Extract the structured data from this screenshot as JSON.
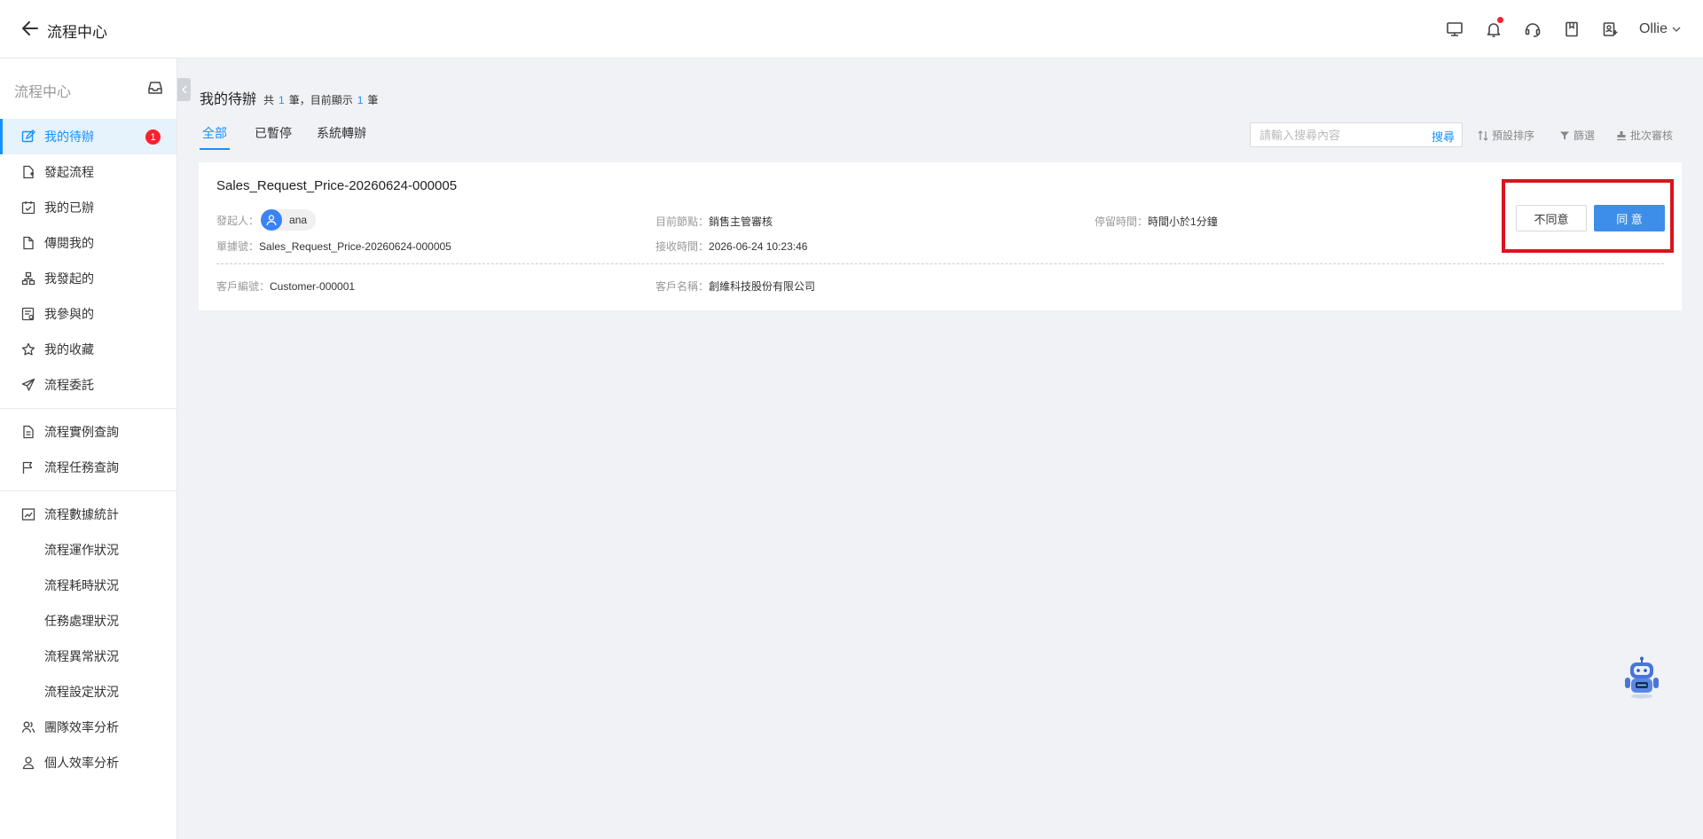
{
  "header": {
    "title": "流程中心",
    "user": "Ollie"
  },
  "sidebar": {
    "title": "流程中心",
    "items": [
      {
        "label": "我的待辦",
        "badge": "1"
      },
      {
        "label": "發起流程"
      },
      {
        "label": "我的已辦"
      },
      {
        "label": "傳閱我的"
      },
      {
        "label": "我發起的"
      },
      {
        "label": "我參與的"
      },
      {
        "label": "我的收藏"
      },
      {
        "label": "流程委託"
      },
      {
        "label": "流程實例查詢"
      },
      {
        "label": "流程任務查詢"
      },
      {
        "label": "流程數據統計"
      },
      {
        "label": "流程運作狀況"
      },
      {
        "label": "流程耗時狀況"
      },
      {
        "label": "任務處理狀況"
      },
      {
        "label": "流程異常狀況"
      },
      {
        "label": "流程設定狀況"
      },
      {
        "label": "團隊效率分析"
      },
      {
        "label": "個人效率分析"
      }
    ]
  },
  "main": {
    "title": "我的待辦",
    "count_prefix": "共",
    "total": "1",
    "count_mid": "筆，目前顯示",
    "shown": "1",
    "count_suffix": "筆",
    "tabs": [
      "全部",
      "已暫停",
      "系統轉辦"
    ],
    "search": {
      "placeholder": "請輸入搜尋內容",
      "button": "搜尋"
    },
    "tools": {
      "sort": "預設排序",
      "filter": "篩選",
      "batch": "批次審核"
    }
  },
  "card": {
    "title": "Sales_Request_Price-20260624-000005",
    "initiator_label": "發起人：",
    "initiator": "ana",
    "node_label": "目前節點：",
    "node": "銷售主管審核",
    "stay_label": "停留時間：",
    "stay": "時間小於1分鐘",
    "doc_no_label": "單據號：",
    "doc_no": "Sales_Request_Price-20260624-000005",
    "received_label": "接收時間：",
    "received": "2026-06-24 10:23:46",
    "customer_no_label": "客戶編號：",
    "customer_no": "Customer-000001",
    "customer_name_label": "客戶名稱：",
    "customer_name": "創維科技股份有限公司",
    "reject_label": "不同意",
    "approve_label": "同 意"
  },
  "colors": {
    "accent": "#1890ff",
    "approve": "#3d8ee8",
    "highlight": "#d9141d",
    "badge": "#f5222d"
  }
}
